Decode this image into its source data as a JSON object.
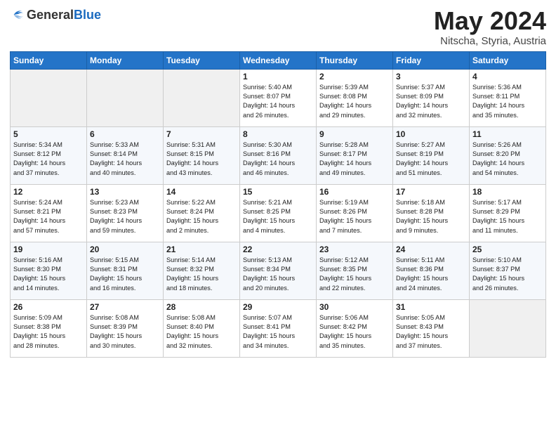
{
  "logo": {
    "general": "General",
    "blue": "Blue"
  },
  "title": {
    "month_year": "May 2024",
    "location": "Nitscha, Styria, Austria"
  },
  "days_of_week": [
    "Sunday",
    "Monday",
    "Tuesday",
    "Wednesday",
    "Thursday",
    "Friday",
    "Saturday"
  ],
  "weeks": [
    [
      {
        "day": "",
        "info": ""
      },
      {
        "day": "",
        "info": ""
      },
      {
        "day": "",
        "info": ""
      },
      {
        "day": "1",
        "info": "Sunrise: 5:40 AM\nSunset: 8:07 PM\nDaylight: 14 hours\nand 26 minutes."
      },
      {
        "day": "2",
        "info": "Sunrise: 5:39 AM\nSunset: 8:08 PM\nDaylight: 14 hours\nand 29 minutes."
      },
      {
        "day": "3",
        "info": "Sunrise: 5:37 AM\nSunset: 8:09 PM\nDaylight: 14 hours\nand 32 minutes."
      },
      {
        "day": "4",
        "info": "Sunrise: 5:36 AM\nSunset: 8:11 PM\nDaylight: 14 hours\nand 35 minutes."
      }
    ],
    [
      {
        "day": "5",
        "info": "Sunrise: 5:34 AM\nSunset: 8:12 PM\nDaylight: 14 hours\nand 37 minutes."
      },
      {
        "day": "6",
        "info": "Sunrise: 5:33 AM\nSunset: 8:14 PM\nDaylight: 14 hours\nand 40 minutes."
      },
      {
        "day": "7",
        "info": "Sunrise: 5:31 AM\nSunset: 8:15 PM\nDaylight: 14 hours\nand 43 minutes."
      },
      {
        "day": "8",
        "info": "Sunrise: 5:30 AM\nSunset: 8:16 PM\nDaylight: 14 hours\nand 46 minutes."
      },
      {
        "day": "9",
        "info": "Sunrise: 5:28 AM\nSunset: 8:17 PM\nDaylight: 14 hours\nand 49 minutes."
      },
      {
        "day": "10",
        "info": "Sunrise: 5:27 AM\nSunset: 8:19 PM\nDaylight: 14 hours\nand 51 minutes."
      },
      {
        "day": "11",
        "info": "Sunrise: 5:26 AM\nSunset: 8:20 PM\nDaylight: 14 hours\nand 54 minutes."
      }
    ],
    [
      {
        "day": "12",
        "info": "Sunrise: 5:24 AM\nSunset: 8:21 PM\nDaylight: 14 hours\nand 57 minutes."
      },
      {
        "day": "13",
        "info": "Sunrise: 5:23 AM\nSunset: 8:23 PM\nDaylight: 14 hours\nand 59 minutes."
      },
      {
        "day": "14",
        "info": "Sunrise: 5:22 AM\nSunset: 8:24 PM\nDaylight: 15 hours\nand 2 minutes."
      },
      {
        "day": "15",
        "info": "Sunrise: 5:21 AM\nSunset: 8:25 PM\nDaylight: 15 hours\nand 4 minutes."
      },
      {
        "day": "16",
        "info": "Sunrise: 5:19 AM\nSunset: 8:26 PM\nDaylight: 15 hours\nand 7 minutes."
      },
      {
        "day": "17",
        "info": "Sunrise: 5:18 AM\nSunset: 8:28 PM\nDaylight: 15 hours\nand 9 minutes."
      },
      {
        "day": "18",
        "info": "Sunrise: 5:17 AM\nSunset: 8:29 PM\nDaylight: 15 hours\nand 11 minutes."
      }
    ],
    [
      {
        "day": "19",
        "info": "Sunrise: 5:16 AM\nSunset: 8:30 PM\nDaylight: 15 hours\nand 14 minutes."
      },
      {
        "day": "20",
        "info": "Sunrise: 5:15 AM\nSunset: 8:31 PM\nDaylight: 15 hours\nand 16 minutes."
      },
      {
        "day": "21",
        "info": "Sunrise: 5:14 AM\nSunset: 8:32 PM\nDaylight: 15 hours\nand 18 minutes."
      },
      {
        "day": "22",
        "info": "Sunrise: 5:13 AM\nSunset: 8:34 PM\nDaylight: 15 hours\nand 20 minutes."
      },
      {
        "day": "23",
        "info": "Sunrise: 5:12 AM\nSunset: 8:35 PM\nDaylight: 15 hours\nand 22 minutes."
      },
      {
        "day": "24",
        "info": "Sunrise: 5:11 AM\nSunset: 8:36 PM\nDaylight: 15 hours\nand 24 minutes."
      },
      {
        "day": "25",
        "info": "Sunrise: 5:10 AM\nSunset: 8:37 PM\nDaylight: 15 hours\nand 26 minutes."
      }
    ],
    [
      {
        "day": "26",
        "info": "Sunrise: 5:09 AM\nSunset: 8:38 PM\nDaylight: 15 hours\nand 28 minutes."
      },
      {
        "day": "27",
        "info": "Sunrise: 5:08 AM\nSunset: 8:39 PM\nDaylight: 15 hours\nand 30 minutes."
      },
      {
        "day": "28",
        "info": "Sunrise: 5:08 AM\nSunset: 8:40 PM\nDaylight: 15 hours\nand 32 minutes."
      },
      {
        "day": "29",
        "info": "Sunrise: 5:07 AM\nSunset: 8:41 PM\nDaylight: 15 hours\nand 34 minutes."
      },
      {
        "day": "30",
        "info": "Sunrise: 5:06 AM\nSunset: 8:42 PM\nDaylight: 15 hours\nand 35 minutes."
      },
      {
        "day": "31",
        "info": "Sunrise: 5:05 AM\nSunset: 8:43 PM\nDaylight: 15 hours\nand 37 minutes."
      },
      {
        "day": "",
        "info": ""
      }
    ]
  ]
}
